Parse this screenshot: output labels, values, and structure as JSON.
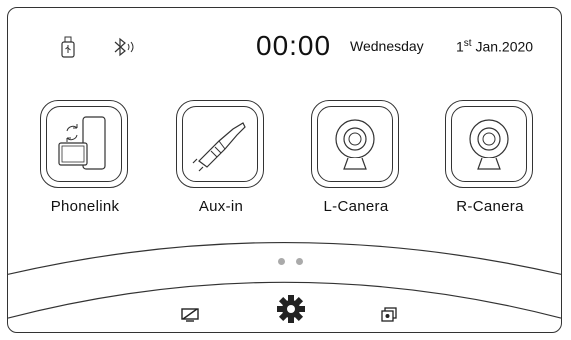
{
  "status_bar": {
    "time": "00:00",
    "weekday": "Wednesday",
    "date_day": "1",
    "date_suffix": "st",
    "date_rest": " Jan.2020",
    "icons": [
      "usb-icon",
      "bluetooth-icon"
    ]
  },
  "apps": [
    {
      "label": "Phonelink",
      "icon": "phonelink-icon"
    },
    {
      "label": "Aux-in",
      "icon": "aux-cable-icon"
    },
    {
      "label": "L-Canera",
      "icon": "camera-icon"
    },
    {
      "label": "R-Canera",
      "icon": "camera-icon"
    }
  ],
  "pager": {
    "pages": 2
  },
  "dock": {
    "items": [
      "screen-off-icon",
      "settings-gear-icon",
      "gallery-icon"
    ]
  }
}
